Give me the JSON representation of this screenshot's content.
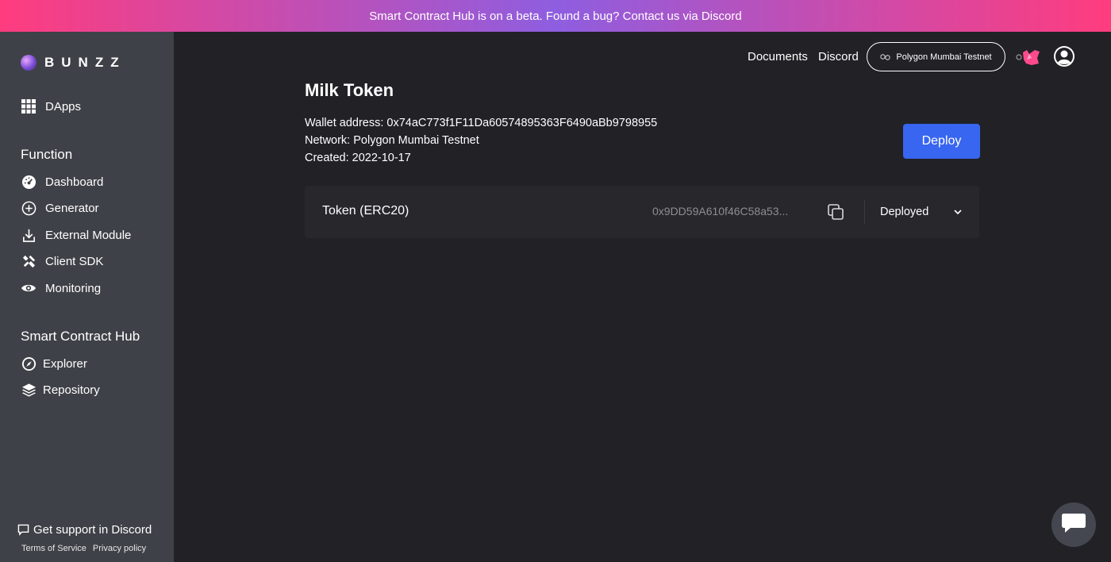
{
  "colors": {
    "banner_gradient": [
      "#ff3c7e",
      "#8e5ee0",
      "#ff3c7e"
    ],
    "sidebar_bg": "#3f4148",
    "main_bg": "#212126",
    "accent": "#3866f0",
    "row_bg": "#27272c"
  },
  "banner": {
    "text": "Smart Contract Hub is on a beta. Found a bug? Contact us via Discord"
  },
  "sidebar": {
    "logo_text": "BUNZZ",
    "top_items": [
      {
        "label": "DApps",
        "icon": "grid-icon"
      }
    ],
    "function_title": "Function",
    "function_items": [
      {
        "label": "Dashboard",
        "icon": "gauge-icon"
      },
      {
        "label": "Generator",
        "icon": "plus-circle-icon"
      },
      {
        "label": "External Module",
        "icon": "download-icon"
      },
      {
        "label": "Client SDK",
        "icon": "tools-icon"
      },
      {
        "label": "Monitoring",
        "icon": "eye-icon"
      }
    ],
    "hub_title": "Smart Contract Hub",
    "hub_items": [
      {
        "label": "Explorer",
        "icon": "compass-icon"
      },
      {
        "label": "Repository",
        "icon": "layers-icon"
      }
    ],
    "support_label": "Get support in Discord",
    "terms_label": "Terms of Service",
    "privacy_label": "Privacy policy"
  },
  "header": {
    "documents_label": "Documents",
    "discord_label": "Discord",
    "network_label": "Polygon Mumbai Testnet"
  },
  "main": {
    "title": "Milk Token",
    "wallet_line": "Wallet address: 0x74aC773f1F11Da60574895363F6490aBb9798955",
    "network_line": "Network: Polygon Mumbai Testnet",
    "created_line": "Created: 2022-10-17",
    "deploy_label": "Deploy",
    "contract": {
      "name": "Token (ERC20)",
      "address": "0x9DD59A610f46C58a53...",
      "status": "Deployed"
    }
  }
}
